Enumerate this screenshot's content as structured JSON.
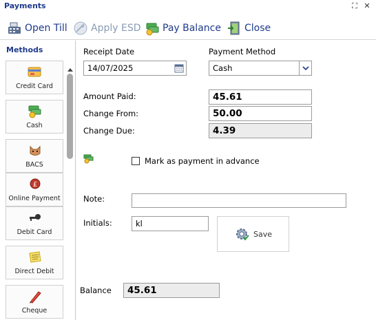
{
  "window": {
    "title": "Payments",
    "restore_glyph": "⛶",
    "close_glyph": "✕"
  },
  "toolbar": {
    "open_till": "Open Till",
    "apply_esd": "Apply ESD",
    "pay_balance": "Pay Balance",
    "close": "Close"
  },
  "sidebar": {
    "heading": "Methods",
    "items": [
      {
        "label": "Credit Card",
        "icon": "credit-card-icon"
      },
      {
        "label": "Cash",
        "icon": "cash-icon"
      },
      {
        "label": "BACS",
        "icon": "bacs-icon"
      },
      {
        "label": "Online Payment",
        "icon": "online-payment-icon"
      },
      {
        "label": "Debit Card",
        "icon": "debit-card-icon"
      },
      {
        "label": "Direct Debit",
        "icon": "direct-debit-icon"
      },
      {
        "label": "Cheque",
        "icon": "cheque-icon"
      }
    ]
  },
  "form": {
    "receipt_date_label": "Receipt Date",
    "receipt_date_value": "14/07/2025",
    "payment_method_label": "Payment Method",
    "payment_method_value": "Cash",
    "amount_paid_label": "Amount Paid:",
    "amount_paid_value": "45.61",
    "change_from_label": "Change From:",
    "change_from_value": "50.00",
    "change_due_label": "Change Due:",
    "change_due_value": "4.39",
    "advance_label": "Mark as payment in advance",
    "advance_checked": false,
    "note_label": "Note:",
    "note_value": "",
    "initials_label": "Initials:",
    "initials_value": "kl",
    "save_label": "Save",
    "balance_label": "Balance",
    "balance_value": "45.61"
  },
  "colors": {
    "accent": "#1e3a8a",
    "disabled": "#8a9bb5",
    "readonly_bg": "#ececec"
  }
}
